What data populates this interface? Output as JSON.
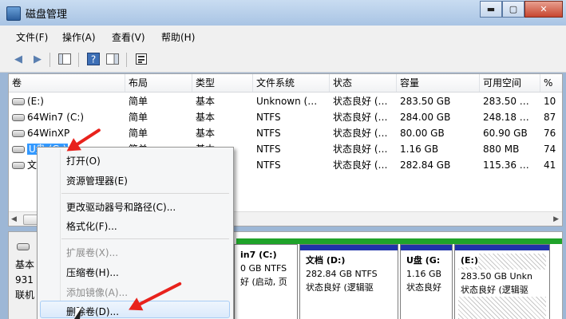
{
  "window": {
    "title": "磁盘管理",
    "buttons": {
      "minimize": "▬",
      "maximize": "▢",
      "close": "✕"
    }
  },
  "menubar": [
    "文件(F)",
    "操作(A)",
    "查看(V)",
    "帮助(H)"
  ],
  "toolbar": {
    "icons": [
      "back-arrow-icon",
      "forward-arrow-icon",
      "console-tree-icon",
      "help-icon",
      "show-hide-icon",
      "properties-icon"
    ]
  },
  "volume_table": {
    "columns": [
      "卷",
      "布局",
      "类型",
      "文件系统",
      "状态",
      "容量",
      "可用空间",
      "%"
    ],
    "rows": [
      [
        "(E:)",
        "简单",
        "基本",
        "Unknown (…",
        "状态良好 (…",
        "283.50 GB",
        "283.50 …",
        "10"
      ],
      [
        "64Win7 (C:)",
        "简单",
        "基本",
        "NTFS",
        "状态良好 (…",
        "284.00 GB",
        "248.18 …",
        "87"
      ],
      [
        "64WinXP",
        "简单",
        "基本",
        "NTFS",
        "状态良好 (…",
        "80.00 GB",
        "60.90 GB",
        "76"
      ],
      [
        "U盘 (G:)",
        "简单",
        "基本",
        "NTFS",
        "状态良好 (…",
        "1.16 GB",
        "880 MB",
        "74"
      ],
      [
        "文",
        "",
        "",
        "NTFS",
        "状态良好 (…",
        "282.84 GB",
        "115.36 …",
        "41"
      ]
    ]
  },
  "disk_panel": {
    "label_lines": [
      "基本",
      "931",
      "联机"
    ],
    "partitions": [
      {
        "name": "in7  (C:)",
        "size": "0 GB NTFS",
        "status": "好 (启动, 页"
      },
      {
        "name": "文档  (D:)",
        "size": "282.84 GB NTFS",
        "status": "状态良好 (逻辑驱"
      },
      {
        "name": "U盘  (G:",
        "size": "1.16 GB",
        "status": "状态良好"
      },
      {
        "name": "(E:)",
        "size": "283.50 GB Unkn",
        "status": "状态良好 (逻辑驱"
      }
    ]
  },
  "context_menu": {
    "items": [
      {
        "label": "打开(O)",
        "enabled": true
      },
      {
        "label": "资源管理器(E)",
        "enabled": true
      },
      {
        "label": "更改驱动器号和路径(C)...",
        "enabled": true
      },
      {
        "label": "格式化(F)...",
        "enabled": true
      },
      {
        "label": "扩展卷(X)...",
        "enabled": false
      },
      {
        "label": "压缩卷(H)...",
        "enabled": true
      },
      {
        "label": "添加镜像(A)...",
        "enabled": false
      },
      {
        "label": "删除卷(D)...",
        "enabled": true
      }
    ]
  },
  "colors": {
    "accent": "#3399ff",
    "partition_cap": "#1f33a8",
    "annotation": "#e8221c"
  }
}
